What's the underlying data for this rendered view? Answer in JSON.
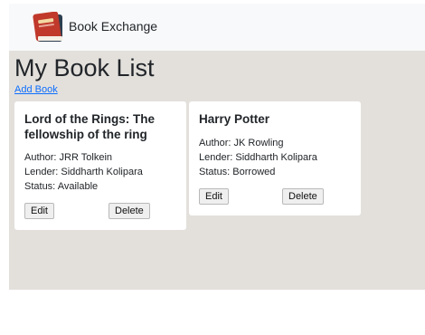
{
  "navbar": {
    "brand": "Book Exchange",
    "logo_icon": "book-icon"
  },
  "page": {
    "title": "My Book List",
    "add_link": "Add Book"
  },
  "books": [
    {
      "title": "Lord of the Rings: The fellowship of the ring",
      "author": "Author: JRR Tolkein",
      "lender": "Lender: Siddharth Kolipara",
      "status": "Status: Available",
      "edit_label": "Edit",
      "delete_label": "Delete"
    },
    {
      "title": "Harry Potter",
      "author": "Author: JK Rowling",
      "lender": "Lender: Siddharth Kolipara",
      "status": "Status: Borrowed",
      "edit_label": "Edit",
      "delete_label": "Delete"
    }
  ],
  "colors": {
    "navbar_bg": "#f8f9fa",
    "content_bg": "#e3e0dc",
    "link": "#0d6efd",
    "logo_red": "#c0392b",
    "logo_navy": "#2c3e50"
  }
}
